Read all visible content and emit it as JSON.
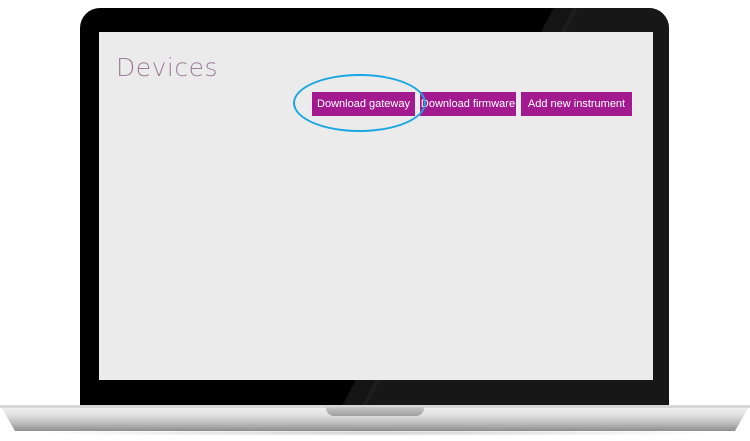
{
  "page": {
    "title": "Devices"
  },
  "actions": {
    "download_gateway": "Download gateway",
    "download_firmware": "Download firmware",
    "add_new_instrument": "Add new instrument"
  },
  "colors": {
    "accent_button": "#a3198f",
    "title_text": "#9c7f99",
    "screen_background": "#ebebeb",
    "highlight_ring": "#1aa6e0"
  }
}
